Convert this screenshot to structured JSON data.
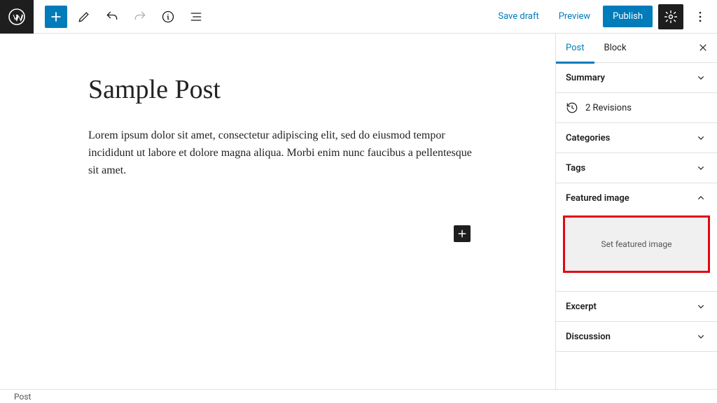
{
  "toolbar": {
    "save_draft": "Save draft",
    "preview": "Preview",
    "publish": "Publish"
  },
  "editor": {
    "title": "Sample Post",
    "body": "Lorem ipsum dolor sit amet, consectetur adipiscing elit, sed do eiusmod tempor incididunt ut labore et dolore magna aliqua. Morbi enim nunc faucibus a pellentesque sit amet."
  },
  "sidebar": {
    "tabs": {
      "post": "Post",
      "block": "Block"
    },
    "panels": {
      "summary": "Summary",
      "revisions": "2 Revisions",
      "categories": "Categories",
      "tags": "Tags",
      "featured_image": "Featured image",
      "set_featured": "Set featured image",
      "excerpt": "Excerpt",
      "discussion": "Discussion"
    }
  },
  "footer": {
    "breadcrumb": "Post"
  }
}
